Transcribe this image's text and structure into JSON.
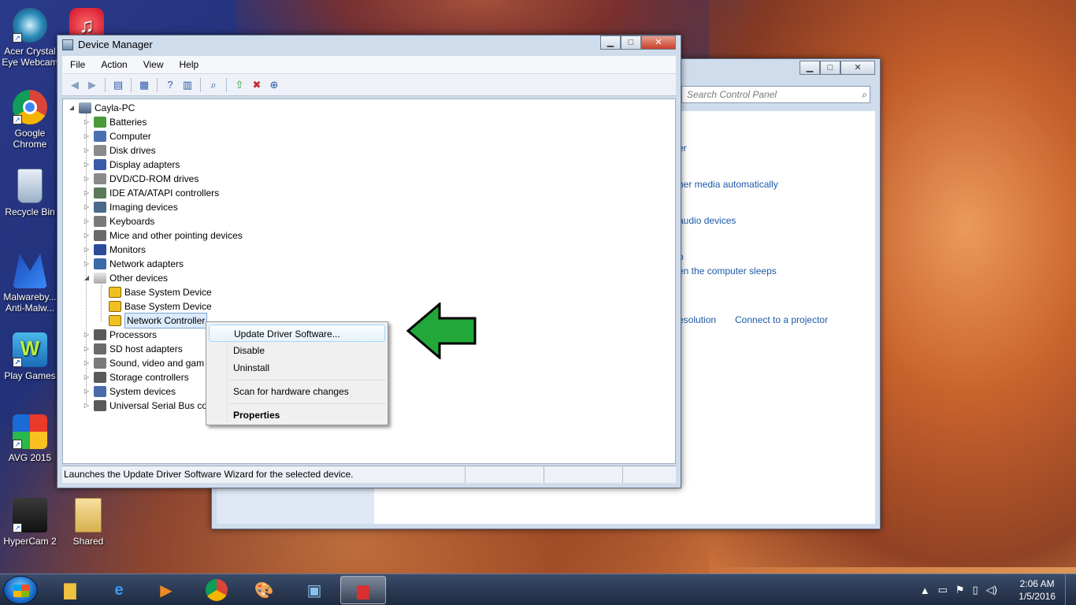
{
  "desktop": {
    "icons": [
      {
        "label": "Acer Crystal Eye Webcam",
        "icon": "webcam-icon"
      },
      {
        "label": "Google Chrome",
        "icon": "chrome-icon"
      },
      {
        "label": "Recycle Bin",
        "icon": "recycle-bin-icon"
      },
      {
        "label": "Malwareby... Anti-Malw...",
        "icon": "malwarebytes-icon"
      },
      {
        "label": "Play Games",
        "icon": "games-icon"
      },
      {
        "label": "AVG 2015",
        "icon": "avg-icon"
      },
      {
        "label": "HyperCam 2",
        "icon": "hypercam-icon"
      },
      {
        "label": "Shared",
        "icon": "folder-icon"
      }
    ]
  },
  "control_panel": {
    "search_placeholder": "Search Control Panel",
    "links": [
      "er",
      "her media automatically",
      "audio devices",
      "p",
      "en the computer sleeps",
      "esolution",
      "Connect to a projector"
    ]
  },
  "device_manager": {
    "title": "Device Manager",
    "menu": [
      "File",
      "Action",
      "View",
      "Help"
    ],
    "root": "Cayla-PC",
    "categories": [
      {
        "label": "Batteries",
        "icon": "battery-icon"
      },
      {
        "label": "Computer",
        "icon": "computer-icon"
      },
      {
        "label": "Disk drives",
        "icon": "disk-drive-icon"
      },
      {
        "label": "Display adapters",
        "icon": "display-adapter-icon"
      },
      {
        "label": "DVD/CD-ROM drives",
        "icon": "dvd-drive-icon"
      },
      {
        "label": "IDE ATA/ATAPI controllers",
        "icon": "ide-controller-icon"
      },
      {
        "label": "Imaging devices",
        "icon": "camera-icon"
      },
      {
        "label": "Keyboards",
        "icon": "keyboard-icon"
      },
      {
        "label": "Mice and other pointing devices",
        "icon": "mouse-icon"
      },
      {
        "label": "Monitors",
        "icon": "monitor-icon"
      },
      {
        "label": "Network adapters",
        "icon": "network-adapter-icon"
      },
      {
        "label": "Other devices",
        "icon": "other-devices-icon"
      }
    ],
    "other_devices_children": [
      {
        "label": "Base System Device"
      },
      {
        "label": "Base System Device"
      },
      {
        "label": "Network Controller"
      }
    ],
    "categories_after": [
      {
        "label": "Processors",
        "icon": "processor-icon"
      },
      {
        "label": "SD host adapters",
        "icon": "sd-card-icon"
      },
      {
        "label": "Sound, video and gam",
        "icon": "speaker-icon"
      },
      {
        "label": "Storage controllers",
        "icon": "storage-icon"
      },
      {
        "label": "System devices",
        "icon": "system-device-icon"
      },
      {
        "label": "Universal Serial Bus co",
        "icon": "usb-icon"
      }
    ],
    "status_text": "Launches the Update Driver Software Wizard for the selected device."
  },
  "context_menu": {
    "update": "Update Driver Software...",
    "disable": "Disable",
    "uninstall": "Uninstall",
    "scan": "Scan for hardware changes",
    "properties": "Properties"
  },
  "taskbar": {
    "time": "2:06 AM",
    "date": "1/5/2016"
  },
  "colors": {
    "arrow_green": "#22a83a",
    "link_blue": "#1c5aa8"
  }
}
